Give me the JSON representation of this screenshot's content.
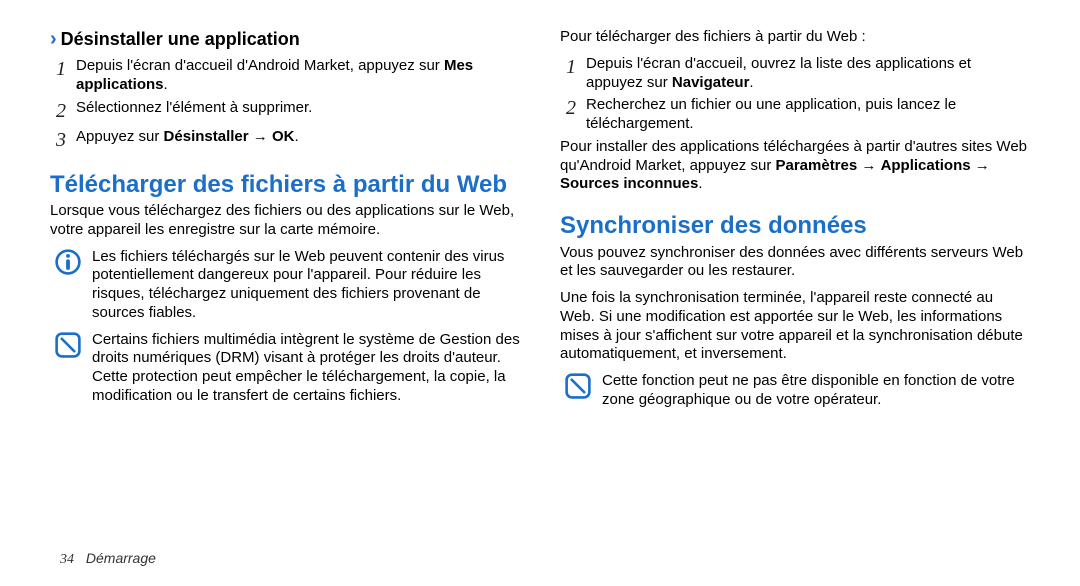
{
  "left": {
    "sub_heading": "Désinstaller une application",
    "steps": [
      {
        "num": "1",
        "html": "Depuis l'écran d'accueil d'Android Market, appuyez sur <b>Mes applications</b>."
      },
      {
        "num": "2",
        "html": "Sélectionnez l'élément à supprimer."
      },
      {
        "num": "3",
        "html": "Appuyez sur <b>Désinstaller</b> → <b>OK</b>."
      }
    ],
    "h1": "Télécharger des fichiers à partir du Web",
    "para": "Lorsque vous téléchargez des fichiers ou des applications sur le Web, votre appareil les enregistre sur la carte mémoire.",
    "warn": "Les fichiers téléchargés sur le Web peuvent contenir des virus potentiellement dangereux pour l'appareil. Pour réduire les risques, téléchargez uniquement des fichiers provenant de sources fiables.",
    "info": "Certains fichiers multimédia intègrent le système de Gestion des droits numériques (DRM) visant à protéger les droits d'auteur. Cette protection peut empêcher le téléchargement, la copie, la modification ou le transfert de certains fichiers."
  },
  "right": {
    "lead": "Pour télécharger des fichiers à partir du Web :",
    "steps": [
      {
        "num": "1",
        "html": "Depuis l'écran d'accueil, ouvrez la liste des applications et appuyez sur <b>Navigateur</b>."
      },
      {
        "num": "2",
        "html": "Recherchez un fichier ou une application, puis lancez le téléchargement."
      }
    ],
    "para2_html": "Pour installer des applications téléchargées à partir d'autres sites Web qu'Android Market, appuyez sur <b>Paramètres</b> → <b>Applications</b> → <b>Sources inconnues</b>.",
    "h1": "Synchroniser des données",
    "para3": "Vous pouvez synchroniser des données avec différents serveurs Web et les sauvegarder ou les restaurer.",
    "para4": "Une fois la synchronisation terminée, l'appareil reste connecté au Web. Si une modification est apportée sur le Web, les informations mises à jour s'affichent sur votre appareil et la synchronisation débute automatiquement, et inversement.",
    "info": "Cette fonction peut ne pas être disponible en fonction de votre zone géographique ou de votre opérateur."
  },
  "footer": {
    "page": "34",
    "section": "Démarrage"
  }
}
